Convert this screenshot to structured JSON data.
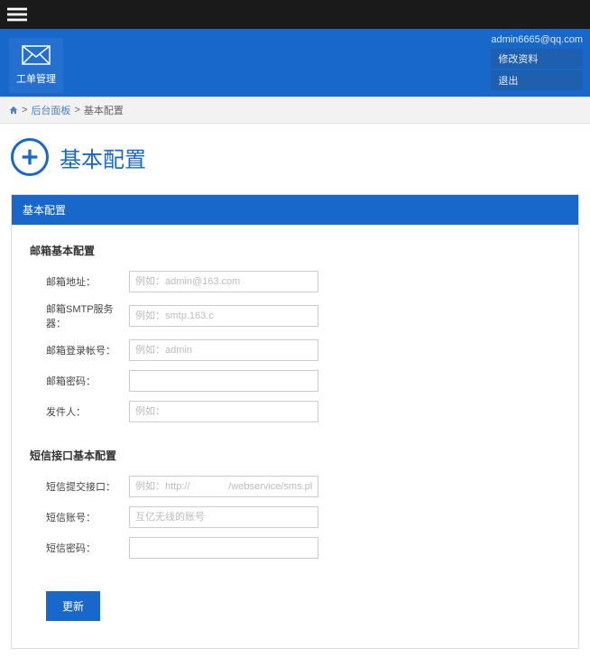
{
  "header": {
    "left_label": "工单管理",
    "user_email": "admin6665@qq.com",
    "menu": {
      "edit_profile": "修改资料",
      "logout": "退出"
    }
  },
  "breadcrumb": {
    "item1": "后台面板",
    "item2": "基本配置"
  },
  "page": {
    "title": "基本配置"
  },
  "panel": {
    "header": "基本配置"
  },
  "section1": {
    "title": "邮箱基本配置",
    "rows": {
      "email_addr": {
        "label": "邮箱地址：",
        "placeholder": "例如：admin@163.com"
      },
      "smtp": {
        "label": "邮箱SMTP服务器：",
        "placeholder": "例如：smtp.163.c"
      },
      "login": {
        "label": "邮箱登录帐号：",
        "placeholder": "例如：admin"
      },
      "password": {
        "label": "邮箱密码：",
        "placeholder": ""
      },
      "sender": {
        "label": "发件人：",
        "placeholder": "例如："
      }
    }
  },
  "section2": {
    "title": "短信接口基本配置",
    "rows": {
      "sms_url": {
        "label": "短信提交接口：",
        "placeholder": "例如：http://              /webservice/sms.php"
      },
      "sms_account": {
        "label": "短信账号：",
        "placeholder": "互亿无线的账号"
      },
      "sms_password": {
        "label": "短信密码：",
        "placeholder": ""
      }
    }
  },
  "submit": {
    "label": "更新"
  }
}
